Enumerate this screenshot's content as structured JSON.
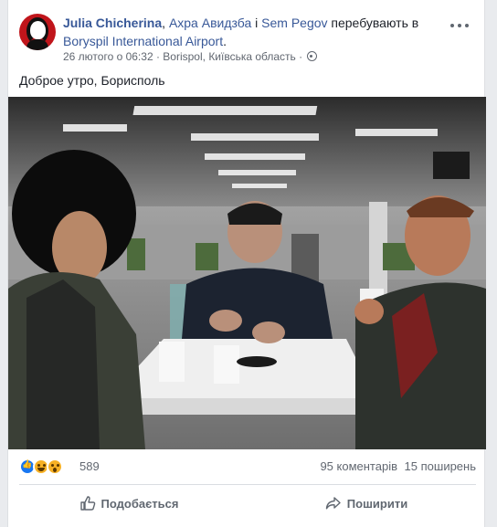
{
  "post": {
    "author": "Julia Chicherina",
    "tagged_sep": ", ",
    "tagged1": "Ахра Авидзба",
    "tagged_and": " і ",
    "tagged2": "Sem Pegov",
    "location_phrase": " перебувають в ",
    "place": "Boryspil International Airport",
    "place_end": ".",
    "timestamp": "26 лютого о 06:32",
    "meta_sep": " · ",
    "meta_place": "Borispol, Київська область",
    "meta_sep2": " · ",
    "text": "Доброе утро, Борисполь",
    "privacy_icon": "globe-icon",
    "more_icon": "more-options-icon"
  },
  "stats": {
    "reaction_icons": [
      "like-reaction-icon",
      "haha-reaction-icon",
      "wow-reaction-icon"
    ],
    "reaction_count": "589",
    "comments": "95 коментарів",
    "shares": "15 поширень"
  },
  "actions": {
    "like_label": "Подобається",
    "share_label": "Поширити",
    "like_icon": "thumbs-up-icon",
    "share_icon": "share-arrow-icon"
  },
  "colors": {
    "link": "#385898",
    "meta": "#616770",
    "like_blue": "#1877f2",
    "avatar_red": "#c0151b"
  }
}
